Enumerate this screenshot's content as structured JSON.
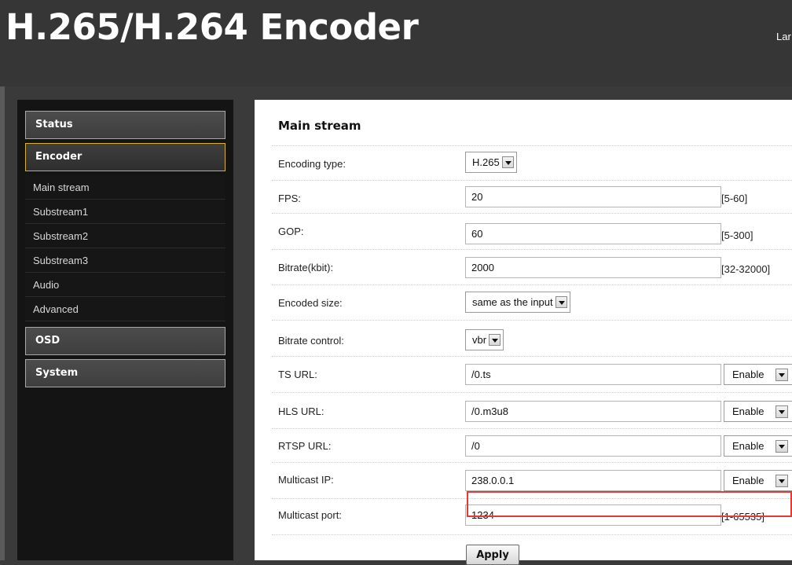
{
  "header": {
    "title": "H.265/H.264 Encoder",
    "lang_label": "Lar"
  },
  "sidebar": {
    "sections": [
      {
        "label": "Status"
      },
      {
        "label": "Encoder"
      },
      {
        "label": "OSD"
      },
      {
        "label": "System"
      }
    ],
    "encoder_items": [
      "Main stream",
      "Substream1",
      "Substream2",
      "Substream3",
      "Audio",
      "Advanced"
    ],
    "active_section": "Encoder"
  },
  "main": {
    "title": "Main stream",
    "fields": {
      "encoding_type": {
        "label": "Encoding type:",
        "value": "H.265"
      },
      "fps": {
        "label": "FPS:",
        "value": "20",
        "range": "[5-60]"
      },
      "gop": {
        "label": "GOP:",
        "value": "60",
        "range": "[5-300]"
      },
      "bitrate": {
        "label": "Bitrate(kbit):",
        "value": "2000",
        "range": "[32-32000]"
      },
      "encoded_size": {
        "label": "Encoded size:",
        "value": "same as the input"
      },
      "bitrate_control": {
        "label": "Bitrate control:",
        "value": "vbr"
      },
      "ts_url": {
        "label": "TS URL:",
        "value": "/0.ts",
        "toggle": "Enable"
      },
      "hls_url": {
        "label": "HLS URL:",
        "value": "/0.m3u8",
        "toggle": "Enable"
      },
      "rtsp_url": {
        "label": "RTSP URL:",
        "value": "/0",
        "toggle": "Enable"
      },
      "multicast_ip": {
        "label": "Multicast IP:",
        "value": "238.0.0.1",
        "toggle": "Enable"
      },
      "multicast_port": {
        "label": "Multicast port:",
        "value": "1234",
        "range": "[1-65535]"
      }
    },
    "apply_label": "Apply"
  },
  "colors": {
    "highlight": "#e53935",
    "active_border": "#d8b12a"
  }
}
